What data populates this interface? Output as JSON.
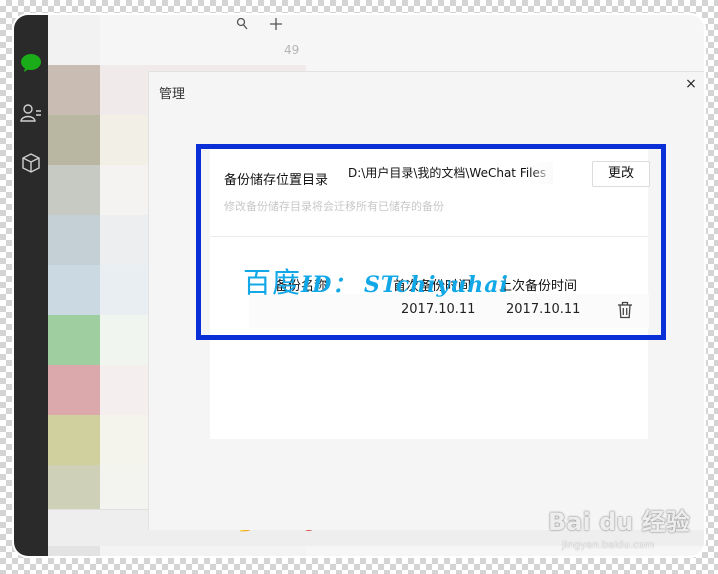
{
  "header": {
    "unread_count": "49"
  },
  "dialog": {
    "title": "管理",
    "close_glyph": "×"
  },
  "backup": {
    "location_label": "备份储存位置目录",
    "path_value": "D:\\用户目录\\我的文档\\WeChat Files",
    "change_button": "更改",
    "hint": "修改备份储存目录将会迁移所有已储存的备份",
    "columns": {
      "name": "备份名称",
      "first": "首次备份时间",
      "last": "上次备份时间"
    },
    "rows": [
      {
        "first": "2017.10.11",
        "last": "2017.10.11"
      }
    ]
  },
  "footer": {
    "emoji_text": "🤔...",
    "mute_glyph": "🔕"
  },
  "watermark": {
    "cn": "百度",
    "latin": "ID： STchiyuhai"
  },
  "logo": {
    "text": "Bai du 经验",
    "url": "jingyan.baidu.com"
  },
  "colors": {
    "highlight": "#0b2fd6",
    "sidebar": "#2a2a2a",
    "wechat_green": "#1aad19",
    "watermark": "#12a8e8"
  },
  "icons": {
    "sidebar": [
      "chat-bubble-icon",
      "contacts-icon",
      "box-icon"
    ],
    "top": [
      "search-icon",
      "plus-icon"
    ],
    "row": "trash-icon"
  },
  "blur_palette": {
    "avatars": [
      "#f2f2f2",
      "#c9bcb3",
      "#b9b6a2",
      "#c7c9c3",
      "#c4d0d6",
      "#cad9e2",
      "#9fcea1",
      "#dba9ac",
      "#d0cf9e",
      "#cfd0b8",
      "#e3e3e3"
    ],
    "rows": [
      "#f6f6f6",
      "#f1eaea",
      "#f2efe7",
      "#f5f3f1",
      "#eceef0",
      "#e9eef3",
      "#f0f5ef",
      "#f4eeee",
      "#f4f3ec",
      "#f3f3ef",
      "#f3f3f3"
    ]
  }
}
